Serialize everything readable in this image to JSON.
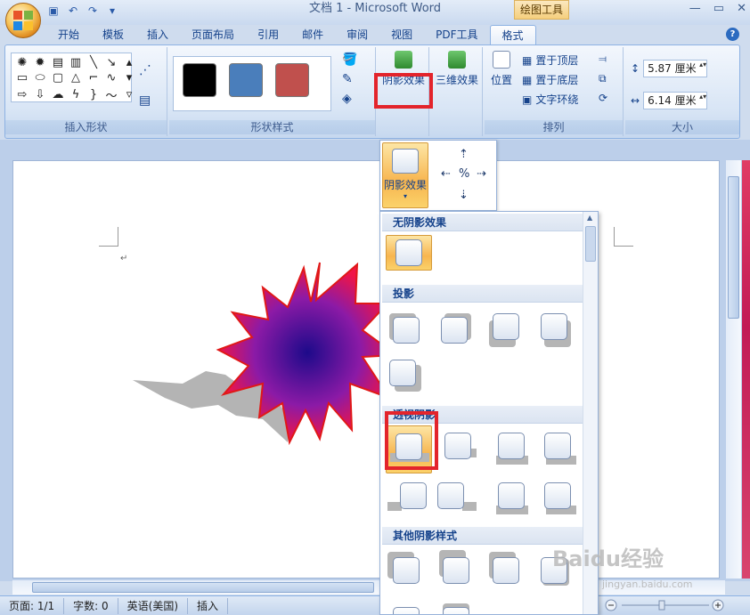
{
  "title_bar": {
    "window_title": "文档 1 - Microsoft Word",
    "context_group": "绘图工具",
    "quick_access": [
      "save-icon",
      "undo-icon",
      "redo-icon",
      "customize-icon"
    ],
    "controls": [
      "—",
      "▭",
      "✕"
    ]
  },
  "tabs": [
    "开始",
    "模板",
    "插入",
    "页面布局",
    "引用",
    "邮件",
    "审阅",
    "视图",
    "PDF工具",
    "格式"
  ],
  "active_tab": "格式",
  "ribbon": {
    "insert_shapes_label": "插入形状",
    "shape_styles_label": "形状样式",
    "shape_style_colors": [
      "#000000",
      "#4a7ebb",
      "#c0504d"
    ],
    "shadow_effects_label": "阴影效果",
    "threed_effects_label": "三维效果",
    "arrange_label": "排列",
    "position_label": "位置",
    "bring_front_label": "置于顶层",
    "send_back_label": "置于底层",
    "text_wrap_label": "文字环绕",
    "size_label": "大小",
    "height_value": "5.87 厘米",
    "width_value": "6.14 厘米"
  },
  "shadow_dropdown": {
    "button_label": "阴影效果",
    "sections": {
      "none": "无阴影效果",
      "drop": "投影",
      "perspective": "透视阴影",
      "other": "其他阴影样式"
    }
  },
  "statusbar": {
    "page": "页面: 1/1",
    "words": "字数: 0",
    "language": "英语(美国)",
    "mode": "插入"
  },
  "watermark": {
    "text": "Baidu经验",
    "url": "jingyan.baidu.com"
  },
  "colors": {
    "highlight_red": "#e3242b",
    "selected_orange": "#f7b54f",
    "ribbon_blue": "#15428b"
  }
}
